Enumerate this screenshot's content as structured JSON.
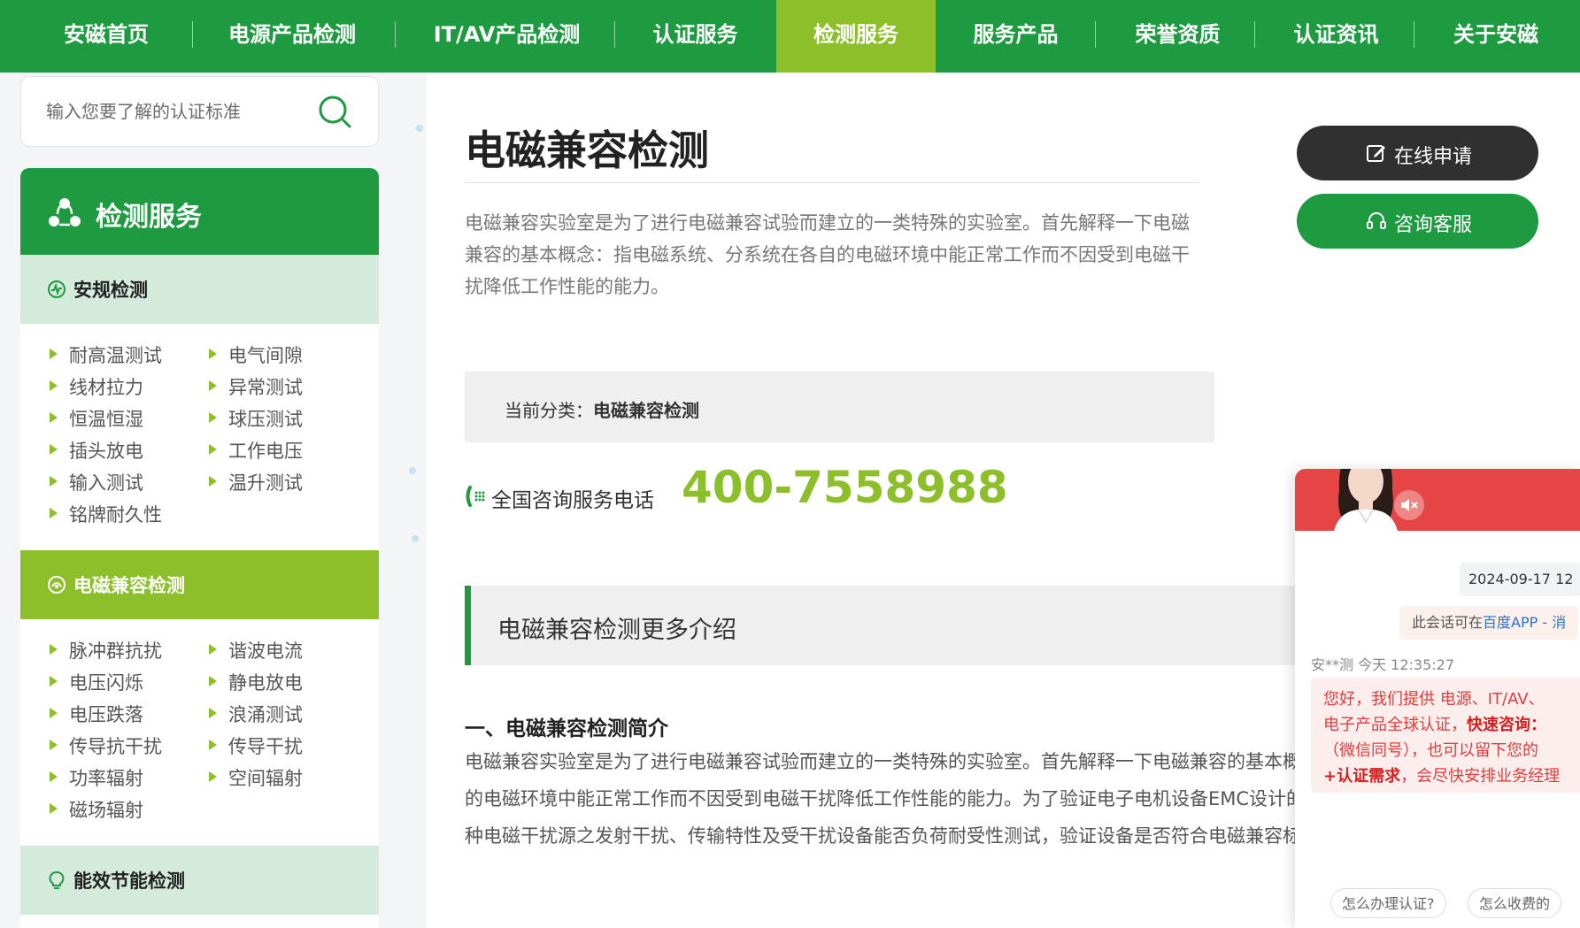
{
  "nav": {
    "items": [
      "安磁首页",
      "电源产品检测",
      "IT/AV产品检测",
      "认证服务",
      "检测服务",
      "服务产品",
      "荣誉资质",
      "认证资讯",
      "关于安磁"
    ],
    "active_index": 4
  },
  "search": {
    "placeholder": "输入您要了解的认证标准"
  },
  "sidebar": {
    "title": "检测服务",
    "categories": [
      {
        "title": "安规检测",
        "items": [
          "耐高温测试",
          "电气间隙",
          "线材拉力",
          "异常测试",
          "恒温恒湿",
          "球压测试",
          "插头放电",
          "工作电压",
          "输入测试",
          "温升测试",
          "铭牌耐久性"
        ]
      },
      {
        "title": "电磁兼容检测",
        "items": [
          "脉冲群抗扰",
          "谐波电流",
          "电压闪烁",
          "静电放电",
          "电压跌落",
          "浪涌测试",
          "传导抗干扰",
          "传导干扰",
          "功率辐射",
          "空间辐射",
          "磁场辐射"
        ]
      },
      {
        "title": "能效节能检测",
        "items": []
      }
    ]
  },
  "main": {
    "title": "电磁兼容检测",
    "intro": "电磁兼容实验室是为了进行电磁兼容试验而建立的一类特殊的实验室。首先解释一下电磁兼容的基本概念：指电磁系统、分系统在各自的电磁环境中能正常工作而不因受到电磁干扰降低工作性能的能力。",
    "apply_label": "在线申请",
    "consult_label": "咨询客服",
    "current_category_label": "当前分类：",
    "current_category_value": "电磁兼容检测",
    "hotline_label": "全国咨询服务电话",
    "hotline_number": "400-7558988",
    "more_title": "电磁兼容检测更多介绍",
    "section_heading": "一、电磁兼容检测简介",
    "section_body": "电磁兼容实验室是为了进行电磁兼容试验而建立的一类特殊的实验室。首先解释一下电磁兼容的基本概念：指电磁系统、分系统在各自的电磁环境中能正常工作而不因受到电磁干扰降低工作性能的能力。为了验证电子电机设备EMC设计的合理性，在整个过程中，对各种电磁干扰源之发射干扰、传输特性及受干扰设备能否负荷耐受性测试，验证设备是否符合电磁兼容标准和规范。"
  },
  "chat": {
    "time": "2024-09-17 12",
    "notice_prefix": "此会话可在",
    "notice_link": "百度APP - 消",
    "agent_line": "安**测 今天 12:35:27",
    "bubble_lines": [
      "您好，我们提供 电源、IT/AV、",
      "电子产品全球认证，",
      "（微信同号），也可以留下您的",
      "，会尽快安排业务经理"
    ],
    "bubble_strong_1": "快速咨询：",
    "bubble_strong_2": "+认证需求",
    "quick_1": "怎么办理认证?",
    "quick_2": "怎么收费的"
  },
  "colors": {
    "primary_green": "#1e9a41",
    "accent_green": "#8cbf2a",
    "dark_button": "#303030",
    "chat_red": "#e64545"
  }
}
